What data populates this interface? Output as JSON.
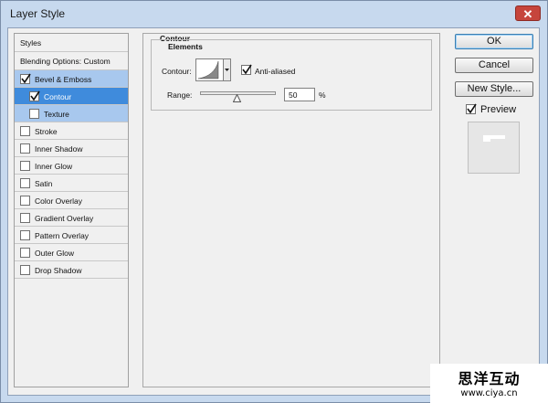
{
  "window": {
    "title": "Layer Style",
    "close_glyph": "✕"
  },
  "styles_list": {
    "header": "Styles",
    "blending_options": "Blending Options: Custom",
    "items": [
      {
        "label": "Bevel & Emboss",
        "checked": true,
        "state": "selected-parent"
      },
      {
        "label": "Contour",
        "checked": true,
        "state": "active",
        "indent": true
      },
      {
        "label": "Texture",
        "checked": false,
        "state": "selected-child",
        "indent": true
      },
      {
        "label": "Stroke",
        "checked": false
      },
      {
        "label": "Inner Shadow",
        "checked": false
      },
      {
        "label": "Inner Glow",
        "checked": false
      },
      {
        "label": "Satin",
        "checked": false
      },
      {
        "label": "Color Overlay",
        "checked": false
      },
      {
        "label": "Gradient Overlay",
        "checked": false
      },
      {
        "label": "Pattern Overlay",
        "checked": false
      },
      {
        "label": "Outer Glow",
        "checked": false
      },
      {
        "label": "Drop Shadow",
        "checked": false
      }
    ]
  },
  "contour_panel": {
    "section_title": "Contour",
    "group_title": "Elements",
    "contour_label": "Contour:",
    "anti_aliased_label": "Anti-aliased",
    "anti_aliased_checked": true,
    "range_label": "Range:",
    "range_value": "50",
    "range_unit": "%",
    "range_fraction": 0.5
  },
  "buttons": {
    "ok": "OK",
    "cancel": "Cancel",
    "new_style": "New Style...",
    "preview_label": "Preview",
    "preview_checked": true
  },
  "watermark": {
    "title": "思洋互动",
    "url": "www.ciya.cn"
  },
  "colors": {
    "selection_dark": "#3f8bdc",
    "selection_light": "#a8c8ee",
    "close_button": "#c6453c"
  }
}
